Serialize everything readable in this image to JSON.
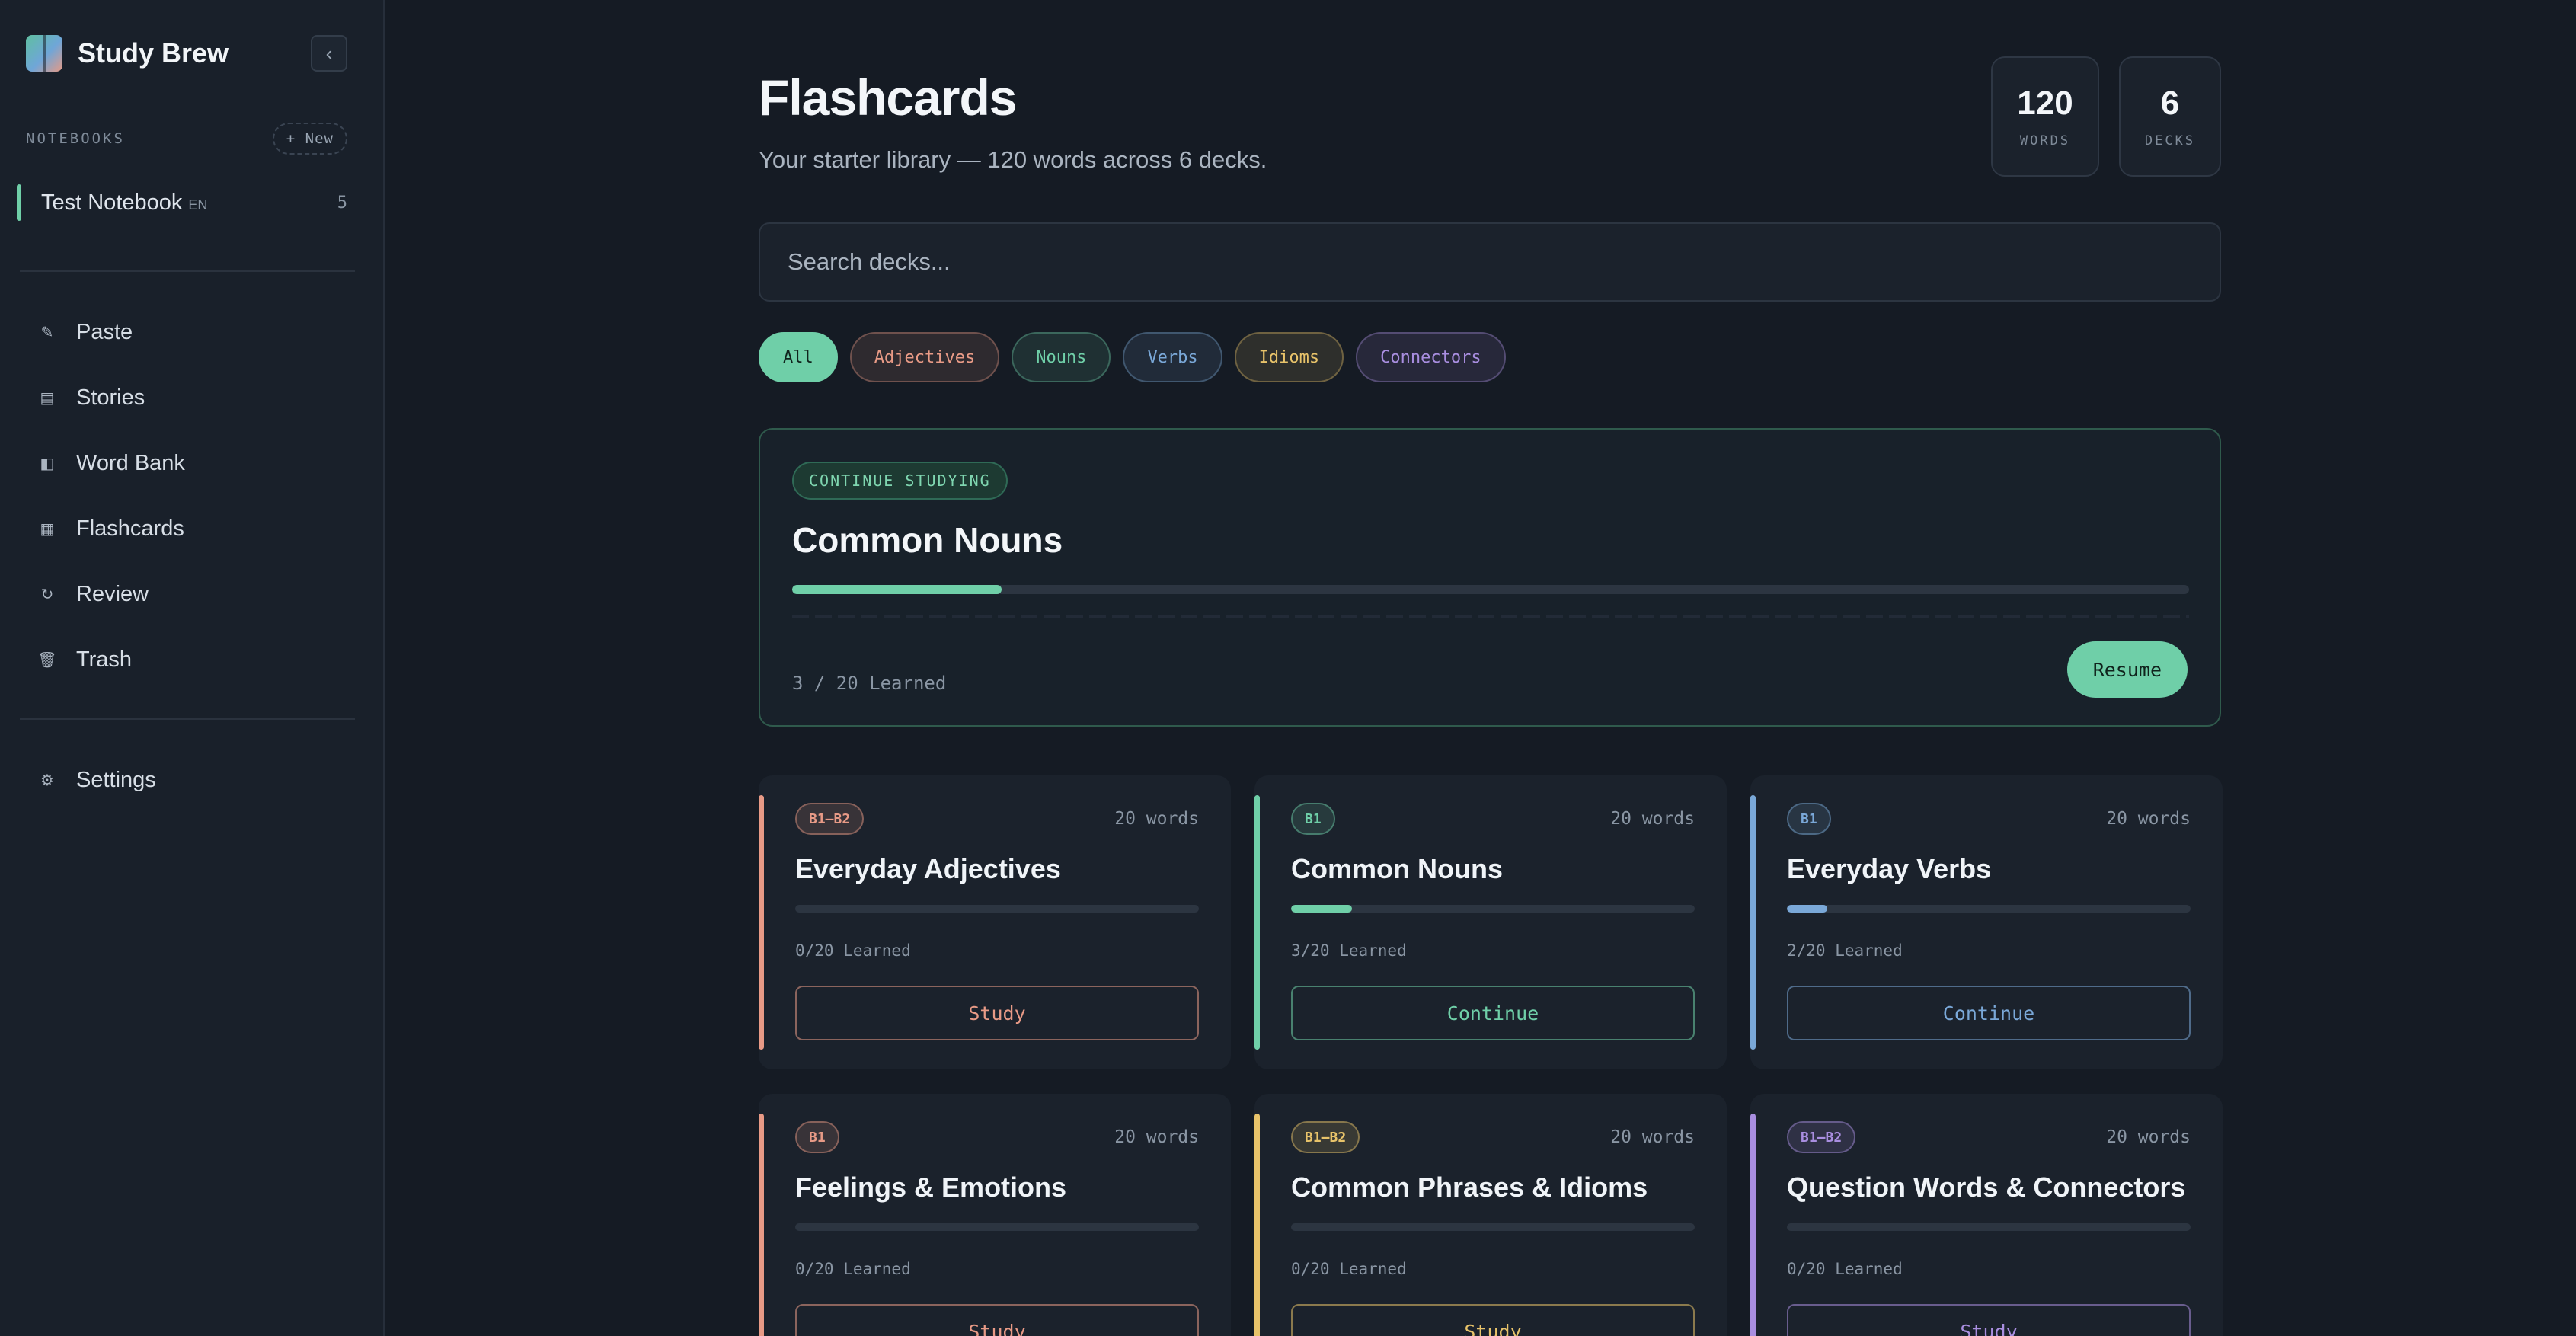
{
  "app": {
    "name": "Study Brew",
    "collapse_icon": "‹"
  },
  "sidebar": {
    "notebooks_title": "NOTEBOOKS",
    "new_label": "+ New",
    "notebook": {
      "name": "Test Notebook",
      "lang": "EN",
      "count": "5"
    },
    "nav": [
      {
        "label": "Paste",
        "icon": "✎"
      },
      {
        "label": "Stories",
        "icon": "▤"
      },
      {
        "label": "Word Bank",
        "icon": "◧"
      },
      {
        "label": "Flashcards",
        "icon": "▦"
      },
      {
        "label": "Review",
        "icon": "↻"
      },
      {
        "label": "Trash",
        "icon": "🗑"
      }
    ],
    "settings": {
      "label": "Settings",
      "icon": "⚙"
    }
  },
  "header": {
    "title": "Flashcards",
    "subtitle": "Your starter library — 120 words across 6 decks."
  },
  "stats": [
    {
      "value": "120",
      "label": "WORDS"
    },
    {
      "value": "6",
      "label": "DECKS"
    }
  ],
  "search": {
    "placeholder": "Search decks..."
  },
  "filters": [
    {
      "label": "All",
      "active": true,
      "color": "#6fcfa8"
    },
    {
      "label": "Adjectives",
      "active": false,
      "color": "#e89a86"
    },
    {
      "label": "Nouns",
      "active": false,
      "color": "#6fcfa8"
    },
    {
      "label": "Verbs",
      "active": false,
      "color": "#7aa8d8"
    },
    {
      "label": "Idioms",
      "active": false,
      "color": "#e8c36a"
    },
    {
      "label": "Connectors",
      "active": false,
      "color": "#a98ee0"
    }
  ],
  "continue": {
    "badge": "CONTINUE STUDYING",
    "title": "Common Nouns",
    "progress": 0.15,
    "learned": "3 / 20 Learned",
    "button": "Resume"
  },
  "decks": [
    {
      "level": "B1–B2",
      "words": "20 words",
      "title": "Everyday Adjectives",
      "learned": "0/20 Learned",
      "progress": 0.0,
      "button": "Study",
      "color": "#e89a86"
    },
    {
      "level": "B1",
      "words": "20 words",
      "title": "Common Nouns",
      "learned": "3/20 Learned",
      "progress": 0.15,
      "button": "Continue",
      "color": "#6fcfa8"
    },
    {
      "level": "B1",
      "words": "20 words",
      "title": "Everyday Verbs",
      "learned": "2/20 Learned",
      "progress": 0.1,
      "button": "Continue",
      "color": "#7aa8d8"
    },
    {
      "level": "B1",
      "words": "20 words",
      "title": "Feelings & Emotions",
      "learned": "0/20 Learned",
      "progress": 0.0,
      "button": "Study",
      "color": "#e89a86"
    },
    {
      "level": "B1–B2",
      "words": "20 words",
      "title": "Common Phrases & Idioms",
      "learned": "0/20 Learned",
      "progress": 0.0,
      "button": "Study",
      "color": "#e8c36a"
    },
    {
      "level": "B1–B2",
      "words": "20 words",
      "title": "Question Words & Connectors",
      "learned": "0/20 Learned",
      "progress": 0.0,
      "button": "Study",
      "color": "#a98ee0"
    }
  ]
}
